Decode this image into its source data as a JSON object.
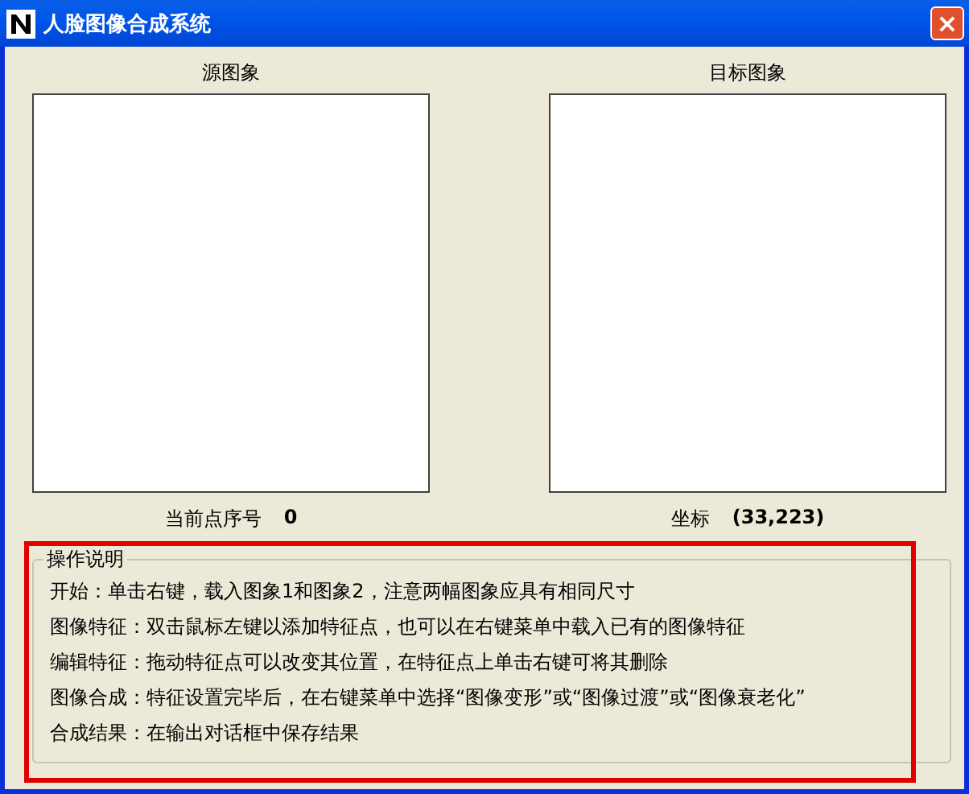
{
  "window": {
    "title": "人脸图像合成系统",
    "close": "×"
  },
  "panels": [
    {
      "label": "源图象"
    },
    {
      "label": "目标图象"
    }
  ],
  "status": [
    {
      "label": "当前点序号",
      "value": "0"
    },
    {
      "label": "坐标",
      "value": "(33,223)"
    }
  ],
  "instructions": {
    "title": "操作说明",
    "highlighted": true,
    "lines": [
      "开始：单击右键，载入图象1和图象2，注意两幅图象应具有相同尺寸",
      "图像特征：双击鼠标左键以添加特征点，也可以在右键菜单中载入已有的图像特征",
      "编辑特征：拖动特征点可以改变其位置，在特征点上单击右键可将其删除",
      "图像合成：特征设置完毕后，在右键菜单中选择“图像变形”或“图像过渡”或“图像衰老化”",
      "合成结果：在输出对话框中保存结果"
    ]
  }
}
